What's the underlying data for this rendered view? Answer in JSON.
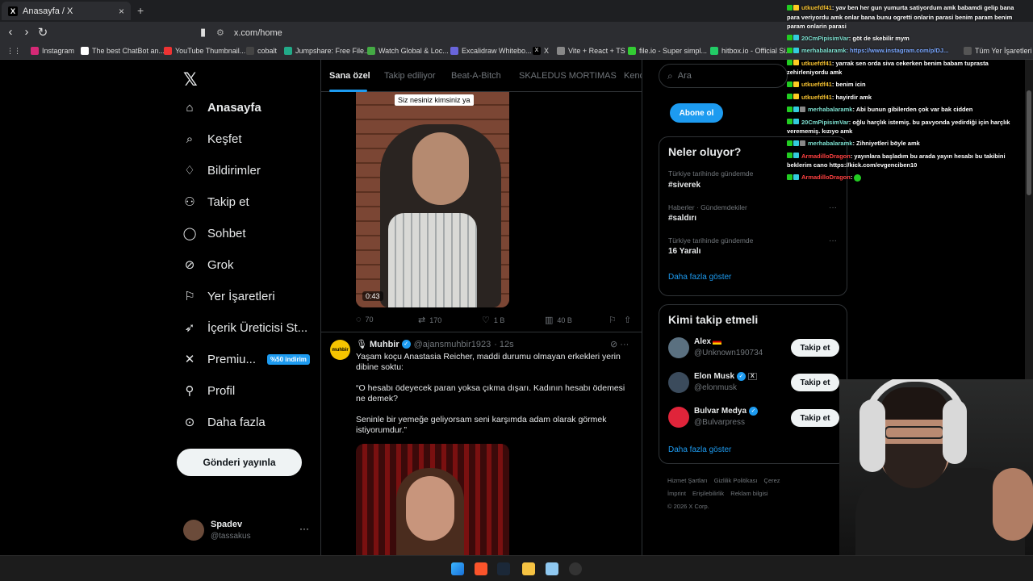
{
  "browser": {
    "tab_title": "Anasayfa / X",
    "tab_close": "×",
    "new_tab": "+",
    "url": "x.com/home",
    "bookmarks": [
      "Instagram",
      "The best ChatBot an...",
      "YouTube Thumbnail...",
      "cobalt",
      "Jumpshare: Free File...",
      "Watch Global & Loc...",
      "Excalidraw Whitebo...",
      "X",
      "Vite + React + TS",
      "file.io - Super simpl...",
      "hitbox.io - Official Si..."
    ],
    "bookmarks_trailing": "Tüm Yer İşaretleri"
  },
  "sidebar": {
    "items": [
      {
        "label": "Anasayfa",
        "icon": "home-icon"
      },
      {
        "label": "Keşfet",
        "icon": "search-icon"
      },
      {
        "label": "Bildirimler",
        "icon": "bell-icon"
      },
      {
        "label": "Takip et",
        "icon": "person-add-icon"
      },
      {
        "label": "Sohbet",
        "icon": "chat-icon"
      },
      {
        "label": "Grok",
        "icon": "grok-icon"
      },
      {
        "label": "Yer İşaretleri",
        "icon": "bookmark-icon"
      },
      {
        "label": "İçerik Üreticisi St...",
        "icon": "rocket-icon"
      },
      {
        "label": "Premiu...",
        "icon": "x-logo-icon"
      },
      {
        "label": "Profil",
        "icon": "person-icon"
      },
      {
        "label": "Daha fazla",
        "icon": "more-circle-icon"
      }
    ],
    "premium_badge": "%50 indirim",
    "post_button": "Gönderi yayınla",
    "user_name": "Spadev",
    "user_handle": "@tassakus",
    "user_more": "···"
  },
  "feed": {
    "tabs": [
      "Sana özel",
      "Takip ediliyor",
      "Beat-A-Bitch",
      "SKALEDUS MORTIMAS",
      "Kend"
    ],
    "tweet1": {
      "caption": "Siz nesiniz kimsiniz ya",
      "duration": "0:43",
      "replies": "70",
      "reposts": "170",
      "likes": "1 B",
      "views": "40 B"
    },
    "tweet2": {
      "avatar_text": "muhbir",
      "name": "Muhbir",
      "handle": "@ajansmuhbir1923",
      "time": "· 12s",
      "text": "Yaşam koçu Anastasia Reicher, maddi durumu olmayan erkekleri yerin dibine soktu:\n\n“O hesabı ödeyecek paran yoksa çıkma dışarı. Kadının hesabı ödemesi ne demek?\n\nSeninle bir yemeğe geliyorsam seni karşımda adam olarak görmek istiyorumdur.”"
    }
  },
  "right": {
    "search_placeholder": "Ara",
    "subscribe_button": "Abone ol",
    "trends_title": "Neler oluyor?",
    "trends": [
      {
        "context": "Türkiye tarihinde gündemde",
        "name": "#siverek"
      },
      {
        "context": "Haberler · Gündemdekiler",
        "name": "#saldırı"
      },
      {
        "context": "Türkiye tarihinde gündemde",
        "name": "16 Yaralı"
      }
    ],
    "trends_more": "Daha fazla göster",
    "follow_title": "Kimi takip etmeli",
    "follow": [
      {
        "name": "Alex",
        "handle": "@Unknown190734",
        "button": "Takip et"
      },
      {
        "name": "Elon Musk",
        "handle": "@elonmusk",
        "button": "Takip et"
      },
      {
        "name": "Bulvar Medya",
        "handle": "@Bulvarpress",
        "button": "Takip et"
      }
    ],
    "follow_more": "Daha fazla göster",
    "footer": [
      "Hizmet Şartları",
      "Gizlilik Politikası",
      "Çerez",
      "İmprint",
      "Erişilebilirlik",
      "Reklam bilgisi",
      "© 2026 X Corp."
    ]
  },
  "chat": [
    {
      "user": "utkuefdf41",
      "color": "yellow",
      "text": ": yav ben her gun yumurta satiyordum amk babamdi gelip bana para veriyordu amk onlar bana bunu ogretti onlarin parasi benim param benim param onlarin parasi"
    },
    {
      "user": "20CmPipisimVar",
      "color": "cyan",
      "text": ": göt de skebilir mym"
    },
    {
      "user": "merhabalaramk",
      "color": "cyan",
      "text": ": https://www.instagram.com/p/DJ..."
    },
    {
      "user": "utkuefdf41",
      "color": "yellow",
      "text": ": yarrak sen orda siva cekerken benim babam tuprasta zehirleniyordu amk"
    },
    {
      "user": "utkuefdf41",
      "color": "yellow",
      "text": ": benim icin"
    },
    {
      "user": "utkuefdf41",
      "color": "yellow",
      "text": ": hayirdir amk"
    },
    {
      "user": "merhabalaramk",
      "color": "cyan",
      "text": ": Abi bunun gibilerden çok var bak cidden"
    },
    {
      "user": "20CmPipisimVar",
      "color": "cyan",
      "text": ": oğlu harçlık istemiş. bu pavyonda yedirdiği için harçlık verememiş. kızıyo amk"
    },
    {
      "user": "merhabalaramk",
      "color": "cyan",
      "text": ": Zihniyetleri böyle amk"
    },
    {
      "user": "ArmadilloDragon",
      "color": "red",
      "text": ": yayınlara başladım bu arada yayın hesabı bu takibini beklerim cano https://kick.com/evgenciben10"
    },
    {
      "user": "ArmadilloDragon",
      "color": "red",
      "text": ":"
    }
  ],
  "colors": {
    "accent": "#1d9bf0",
    "bg": "#000000",
    "border": "#2f3336",
    "muted": "#71767b"
  }
}
